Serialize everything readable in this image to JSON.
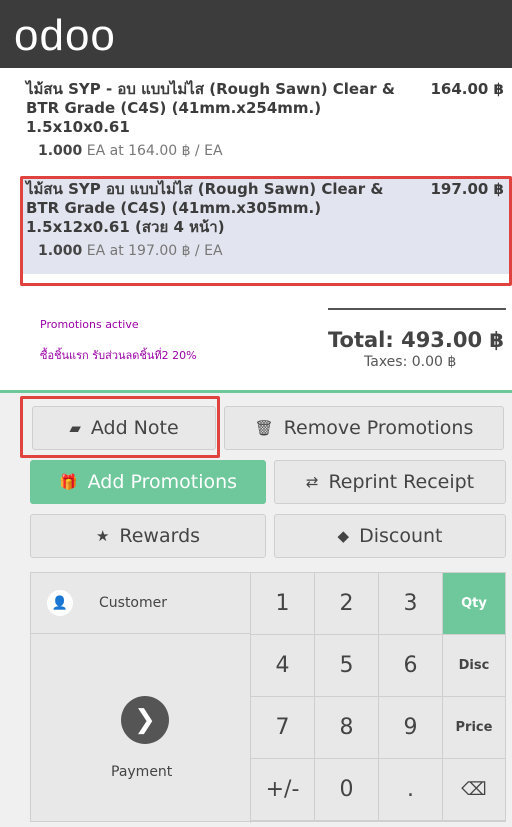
{
  "header": {
    "logo_text": "odoo"
  },
  "orderlines": [
    {
      "name": "ไม้สน SYP - อบ แบบไม่ไส (Rough Sawn) Clear & BTR Grade (C4S) (41mm.x254mm.) 1.5x10x0.61",
      "price": "164.00 ฿",
      "qty": "1.000",
      "unit": "EA at 164.00 ฿ / EA"
    },
    {
      "name": "ไม้สน SYP อบ แบบไม่ไส (Rough Sawn) Clear & BTR Grade (C4S) (41mm.x305mm.) 1.5x12x0.61 (สวย 4 หน้า)",
      "price": "197.00 ฿",
      "qty": "1.000",
      "unit": "EA at 197.00 ฿ / EA"
    }
  ],
  "summary": {
    "promotions_active": "Promotions active",
    "promotion_name": "ซื้อชิ้นแรก รับส่วนลดชิ้นที่2 20%",
    "total": "Total: 493.00 ฿",
    "taxes": "Taxes: 0.00 ฿"
  },
  "control_buttons": {
    "add_note": "Add Note",
    "remove_promotions": "Remove Promotions",
    "add_promotions": "Add Promotions",
    "reprint_receipt": "Reprint Receipt",
    "rewards": "Rewards",
    "discount": "Discount"
  },
  "numpad": {
    "customer": "Customer",
    "payment": "Payment",
    "keys": [
      "1",
      "2",
      "3",
      "4",
      "5",
      "6",
      "7",
      "8",
      "9",
      "+/-",
      "0",
      "."
    ],
    "modes": [
      "Qty",
      "Disc",
      "Price"
    ],
    "backspace": "⌫"
  },
  "colors": {
    "accent": "#6ec89b",
    "highlight": "#e0423e",
    "promo_text": "#9b00a6",
    "topbar": "#3c3c3c"
  }
}
